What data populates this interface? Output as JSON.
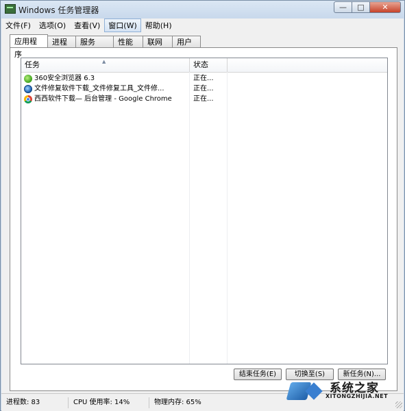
{
  "window": {
    "title": "Windows 任务管理器",
    "controls": {
      "minimize": "—",
      "maximize": "□",
      "close": "✕"
    }
  },
  "menubar": {
    "items": [
      {
        "label": "文件(F)"
      },
      {
        "label": "选项(O)"
      },
      {
        "label": "查看(V)"
      },
      {
        "label": "窗口(W)"
      },
      {
        "label": "帮助(H)"
      }
    ]
  },
  "tabs": [
    {
      "label": "应用程序"
    },
    {
      "label": "进程"
    },
    {
      "label": "服务"
    },
    {
      "label": "性能"
    },
    {
      "label": "联网"
    },
    {
      "label": "用户"
    }
  ],
  "applist": {
    "columns": {
      "task": "任务",
      "status": "状态"
    },
    "rows": [
      {
        "task": "360安全浏览器 6.3",
        "status": "正在...",
        "icon": "360-browser-icon"
      },
      {
        "task": "文件修复软件下载_文件修复工具_文件修...",
        "status": "正在...",
        "icon": "ie-browser-icon"
      },
      {
        "task": "西西软件下载— 后台管理 - Google Chrome",
        "status": "正在...",
        "icon": "chrome-icon"
      }
    ]
  },
  "buttons": {
    "end_task": "结束任务(E)",
    "switch_to": "切换至(S)",
    "new_task": "新任务(N)..."
  },
  "statusbar": {
    "processes": "进程数: 83",
    "cpu": "CPU 使用率: 14%",
    "memory": "物理内存: 65%"
  },
  "watermark": {
    "title": "系统之家",
    "url": "XITONGZHIJIA.NET"
  }
}
